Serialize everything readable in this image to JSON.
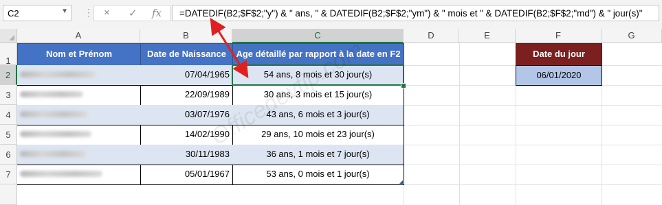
{
  "name_box": {
    "value": "C2"
  },
  "formula_bar": {
    "cancel_icon": "×",
    "confirm_icon": "✓",
    "function_icon": "fx",
    "formula": "=DATEDIF(B2;$F$2;\"y\") & \" ans, \" & DATEDIF(B2;$F$2;\"ym\") & \" mois et \" & DATEDIF(B2;$F$2;\"md\") & \" jour(s)\""
  },
  "columns": [
    "A",
    "B",
    "C",
    "D",
    "E",
    "F",
    "G"
  ],
  "rows": [
    "1",
    "2",
    "3",
    "4",
    "5",
    "6",
    "7"
  ],
  "table": {
    "headers": {
      "name": "Nom et Prénom",
      "birth": "Date de Naissance",
      "age": "Age détaillé par rapport à la date en F2"
    },
    "rows": [
      {
        "birth": "07/04/1965",
        "age": "54 ans, 8 mois et 30 jour(s)"
      },
      {
        "birth": "22/09/1989",
        "age": "30 ans, 3 mois et 15 jour(s)"
      },
      {
        "birth": "03/07/1976",
        "age": "43 ans, 6 mois et 3 jour(s)"
      },
      {
        "birth": "14/02/1990",
        "age": "29 ans, 10 mois et 23 jour(s)"
      },
      {
        "birth": "30/11/1983",
        "age": "36 ans, 1 mois et 7 jour(s)"
      },
      {
        "birth": "05/01/1967",
        "age": "53 ans, 0 mois et 1 jour(s)"
      }
    ]
  },
  "today": {
    "label": "Date du jour",
    "value": "06/01/2020"
  },
  "watermark": "Officedevtip.com",
  "colors": {
    "header_blue": "#4472c4",
    "header_red": "#7b1f1f",
    "band": "#dce5f1",
    "today_fill": "#b4c6e7",
    "selection": "#217346",
    "arrow": "#e02020"
  }
}
